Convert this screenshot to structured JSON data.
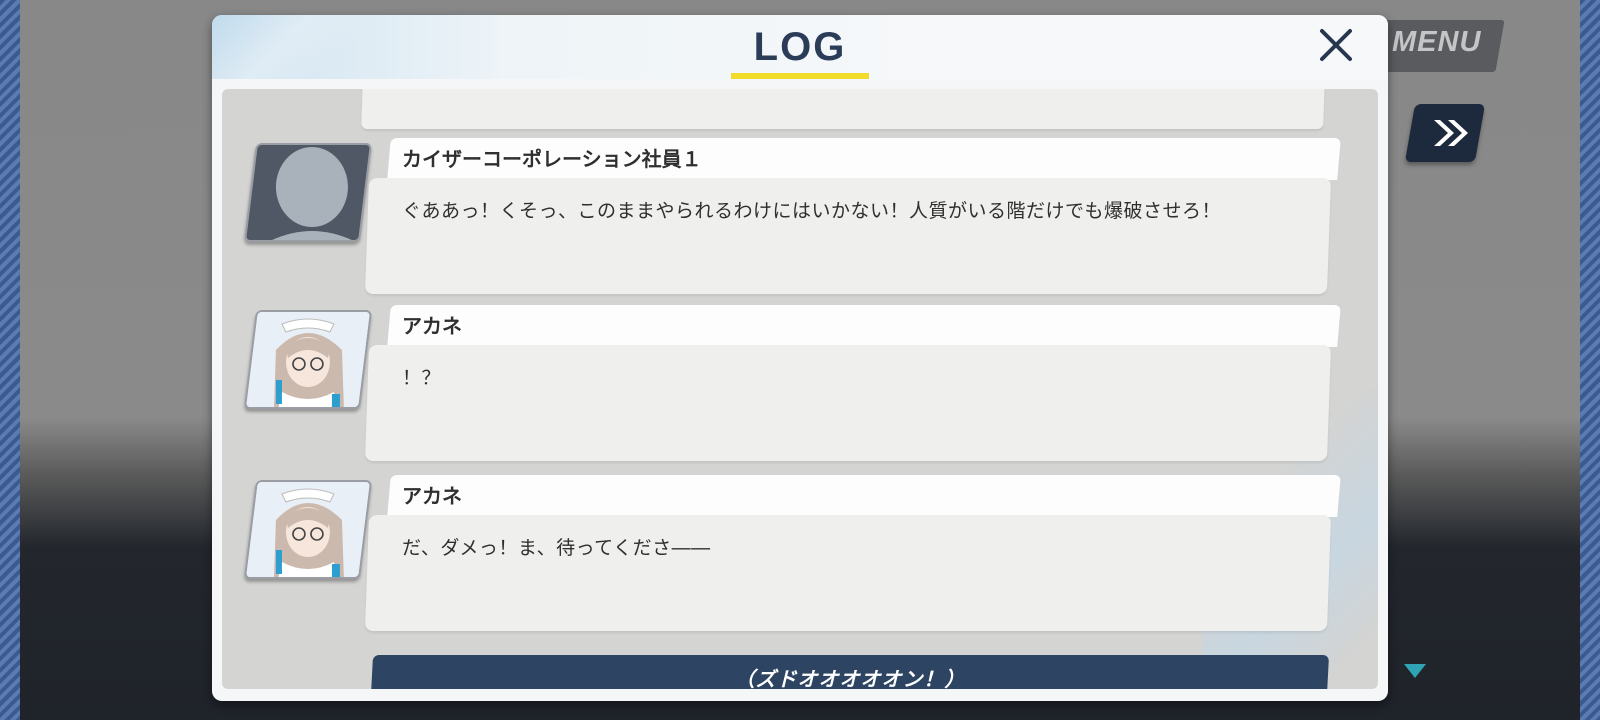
{
  "hud": {
    "menu_label": "MENU"
  },
  "dialog": {
    "title": "LOG"
  },
  "log": {
    "entries": [
      {
        "speaker": "カイザーコーポレーション社員１",
        "text": "ぐああっ！くそっ、このままやられるわけにはいかない！人質がいる階だけでも爆破させろ！",
        "avatar": "silhouette-avatar"
      },
      {
        "speaker": "アカネ",
        "text": "！？",
        "avatar": "akane-portrait"
      },
      {
        "speaker": "アカネ",
        "text": "だ、ダメっ！ま、待ってくださ――",
        "avatar": "akane-portrait"
      }
    ],
    "sfx": "（ズドオオオオオン！）"
  },
  "colors": {
    "title_underline": "#f2dc2a",
    "title_text": "#2b3c58",
    "sfx_bar": "#2e4463",
    "next_indicator": "#2fa4b4"
  }
}
